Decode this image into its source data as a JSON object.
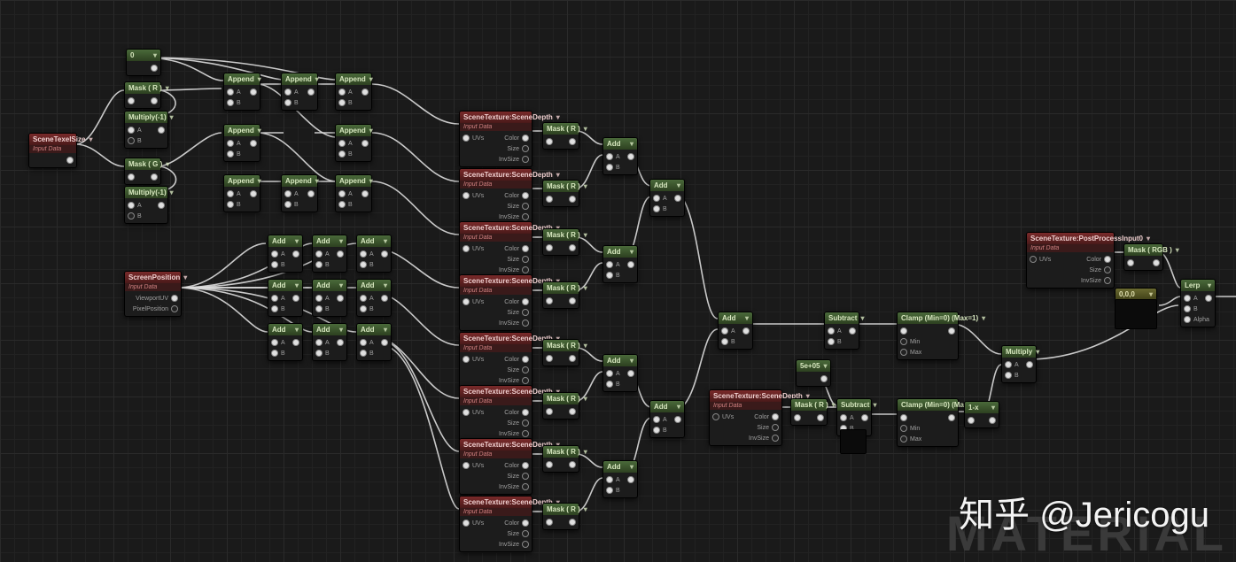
{
  "watermark": "知乎 @Jericogu",
  "material_word": "MATERIAL",
  "labels": {
    "input_data": "Input Data",
    "uvs": "UVs",
    "color": "Color",
    "size": "Size",
    "invsize": "InvSize",
    "viewport_uv": "ViewportUV",
    "pixel_pos": "PixelPosition",
    "a": "A",
    "b": "B",
    "min": "Min",
    "max": "Max",
    "alpha": "Alpha"
  },
  "nodes": {
    "size": {
      "title": "SceneTexelSize"
    },
    "zero": {
      "title": "0"
    },
    "mask_r1": {
      "title": "Mask ( R )"
    },
    "mask_g": {
      "title": "Mask ( G )"
    },
    "mult_n1a": {
      "title": "Multiply(-1)"
    },
    "mult_n1b": {
      "title": "Multiply(-1)"
    },
    "app_a1": {
      "title": "Append"
    },
    "app_a2": {
      "title": "Append"
    },
    "app_a3": {
      "title": "Append"
    },
    "app_b1": {
      "title": "Append"
    },
    "app_b2": {
      "title": "Append"
    },
    "app_b3": {
      "title": "Append"
    },
    "app_c1": {
      "title": "Append"
    },
    "app_c2": {
      "title": "Append"
    },
    "app_c3": {
      "title": "Append"
    },
    "add_a1": {
      "title": "Add"
    },
    "add_a2": {
      "title": "Add"
    },
    "add_a3": {
      "title": "Add"
    },
    "add_b1": {
      "title": "Add"
    },
    "add_b2": {
      "title": "Add"
    },
    "add_b3": {
      "title": "Add"
    },
    "add_c1": {
      "title": "Add"
    },
    "add_c2": {
      "title": "Add"
    },
    "add_c3": {
      "title": "Add"
    },
    "screenpos": {
      "title": "ScreenPosition"
    },
    "st1": {
      "title": "SceneTexture:SceneDepth"
    },
    "st2": {
      "title": "SceneTexture:SceneDepth"
    },
    "st3": {
      "title": "SceneTexture:SceneDepth"
    },
    "st4": {
      "title": "SceneTexture:SceneDepth"
    },
    "st5": {
      "title": "SceneTexture:SceneDepth"
    },
    "st6": {
      "title": "SceneTexture:SceneDepth"
    },
    "st7": {
      "title": "SceneTexture:SceneDepth"
    },
    "st8": {
      "title": "SceneTexture:SceneDepth"
    },
    "stc": {
      "title": "SceneTexture:SceneDepth"
    },
    "ppi": {
      "title": "SceneTexture:PostProcessInput0"
    },
    "mk1": {
      "title": "Mask ( R )"
    },
    "mk2": {
      "title": "Mask ( R )"
    },
    "mk3": {
      "title": "Mask ( R )"
    },
    "mk4": {
      "title": "Mask ( R )"
    },
    "mk5": {
      "title": "Mask ( R )"
    },
    "mk6": {
      "title": "Mask ( R )"
    },
    "mk7": {
      "title": "Mask ( R )"
    },
    "mk8": {
      "title": "Mask ( R )"
    },
    "mkc": {
      "title": "Mask ( R )"
    },
    "mkp": {
      "title": "Mask ( RGB )"
    },
    "p1": {
      "title": "Add"
    },
    "p2": {
      "title": "Add"
    },
    "p3": {
      "title": "Add"
    },
    "p4": {
      "title": "Add"
    },
    "p5": {
      "title": "Add"
    },
    "p6": {
      "title": "Add"
    },
    "sum_all": {
      "title": "Add"
    },
    "sub1": {
      "title": "Subtract"
    },
    "clamp1": {
      "title": "Clamp (Min=0) (Max=1)"
    },
    "fivee5": {
      "title": "5e+05"
    },
    "sub2": {
      "title": "Subtract"
    },
    "clamp2": {
      "title": "Clamp (Min=0) (Max=1)"
    },
    "oneminus": {
      "title": "1-x"
    },
    "mult": {
      "title": "Multiply"
    },
    "lerp": {
      "title": "Lerp"
    },
    "const": {
      "title": "0,0,0"
    }
  }
}
